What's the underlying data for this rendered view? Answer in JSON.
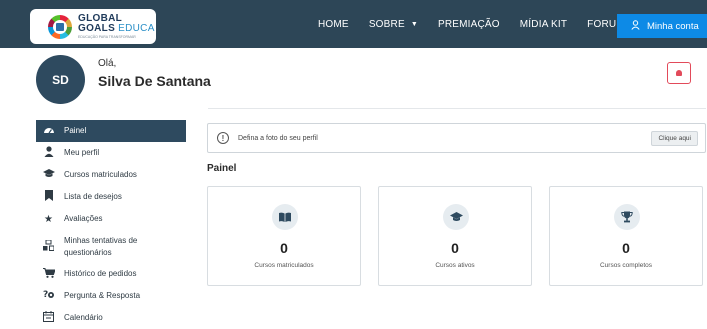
{
  "logo": {
    "line1": "GLOBAL",
    "line2_main": "GOALS",
    "line2_accent": "EDUCA",
    "tagline": "EDUCAÇÃO PARA TRANSFORMAR"
  },
  "nav": {
    "items": [
      {
        "label": "HOME"
      },
      {
        "label": "SOBRE",
        "has_dropdown": true
      },
      {
        "label": "PREMIAÇÃO"
      },
      {
        "label": "MÍDIA KIT"
      },
      {
        "label": "FORUM"
      }
    ],
    "account_label": "Minha conta"
  },
  "profile": {
    "initials": "SD",
    "greeting": "Olá,",
    "name": "Silva De Santana"
  },
  "sidebar": {
    "items": [
      {
        "label": "Painel",
        "icon": "dashboard-icon",
        "active": true
      },
      {
        "label": "Meu perfil",
        "icon": "user-icon"
      },
      {
        "label": "Cursos matriculados",
        "icon": "graduation-cap-icon"
      },
      {
        "label": "Lista de desejos",
        "icon": "bookmark-icon"
      },
      {
        "label": "Avaliações",
        "icon": "star-icon"
      },
      {
        "label": "Minhas tentativas de questionários",
        "icon": "quiz-attempts-icon"
      },
      {
        "label": "Histórico de pedidos",
        "icon": "cart-icon"
      },
      {
        "label": "Pergunta & Resposta",
        "icon": "question-answer-icon"
      },
      {
        "label": "Calendário",
        "icon": "calendar-icon"
      }
    ]
  },
  "alert": {
    "text": "Defina a foto do seu perfil",
    "button": "Clique aqui"
  },
  "dashboard": {
    "title": "Painel",
    "cards": [
      {
        "value": "0",
        "caption": "Cursos matriculados",
        "icon": "book-open-icon"
      },
      {
        "value": "0",
        "caption": "Cursos ativos",
        "icon": "graduation-cap-icon"
      },
      {
        "value": "0",
        "caption": "Cursos completos",
        "icon": "trophy-icon"
      }
    ]
  },
  "colors": {
    "navbar": "#2d4657",
    "accent_button": "#0d8ae6",
    "sidebar_active": "#2e4a5f",
    "bell_accent": "#e24a5a"
  }
}
